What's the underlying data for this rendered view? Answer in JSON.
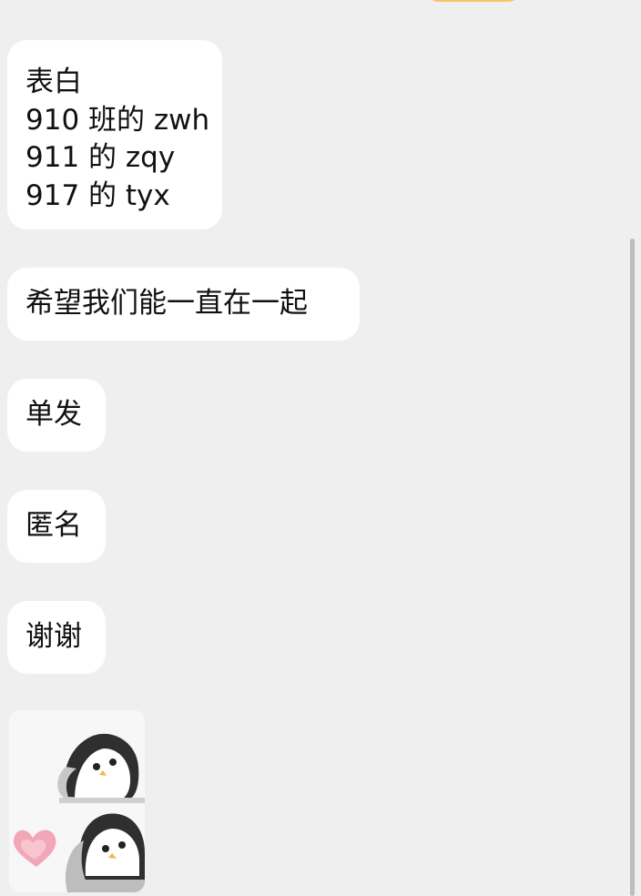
{
  "messages": [
    {
      "lines": [
        "表白",
        "910 班的 zwh",
        "911 的 zqy",
        "917 的 tyx"
      ]
    },
    {
      "text": "希望我们能一直在一起"
    },
    {
      "text": "单发"
    },
    {
      "text": "匿名"
    },
    {
      "text": "谢谢"
    }
  ],
  "sticker": {
    "icon": "penguin-heart-sticker",
    "colors": {
      "heart": "#f2a7b6",
      "penguin_body": "#b9b9b9",
      "penguin_dark": "#2f2f2f"
    }
  },
  "colors": {
    "background": "#efefef",
    "bubble": "#ffffff",
    "top_bubble": "#f7c46a"
  }
}
